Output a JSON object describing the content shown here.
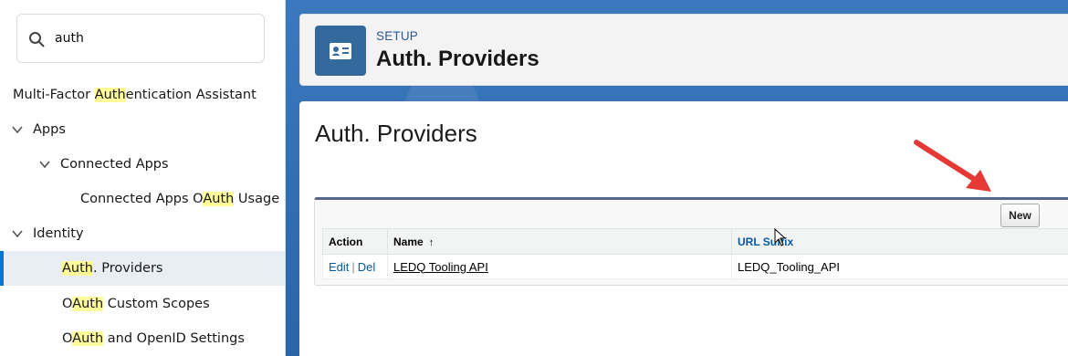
{
  "sidebar": {
    "search": {
      "value": "auth"
    },
    "items": [
      {
        "pre": "Multi-Factor ",
        "mark": "Auth",
        "post": "entication Assistant"
      },
      {
        "pre": "Apps",
        "mark": "",
        "post": ""
      },
      {
        "pre": "Connected Apps",
        "mark": "",
        "post": ""
      },
      {
        "pre": "Connected Apps O",
        "mark": "Auth",
        "post": " Usage"
      },
      {
        "pre": "Identity",
        "mark": "",
        "post": ""
      },
      {
        "pre": "",
        "mark": "Auth",
        "post": ". Providers"
      },
      {
        "pre": "O",
        "mark": "Auth",
        "post": " Custom Scopes"
      },
      {
        "pre": "O",
        "mark": "Auth",
        "post": " and OpenID Settings"
      }
    ]
  },
  "header": {
    "eyebrow": "SETUP",
    "title": "Auth. Providers"
  },
  "page": {
    "title": "Auth. Providers",
    "new_button": "New",
    "columns": {
      "action": "Action",
      "name": "Name",
      "sort_indicator": "↑",
      "url_suffix": "URL Suffix"
    },
    "rows": [
      {
        "edit": "Edit",
        "separator": "|",
        "del": "Del",
        "name": "LEDQ Tooling API",
        "url_suffix": "LEDQ_Tooling_API"
      }
    ]
  },
  "colors": {
    "accent": "#0176d3",
    "highlight": "#fefb9b",
    "annotation_arrow": "#e53935"
  }
}
